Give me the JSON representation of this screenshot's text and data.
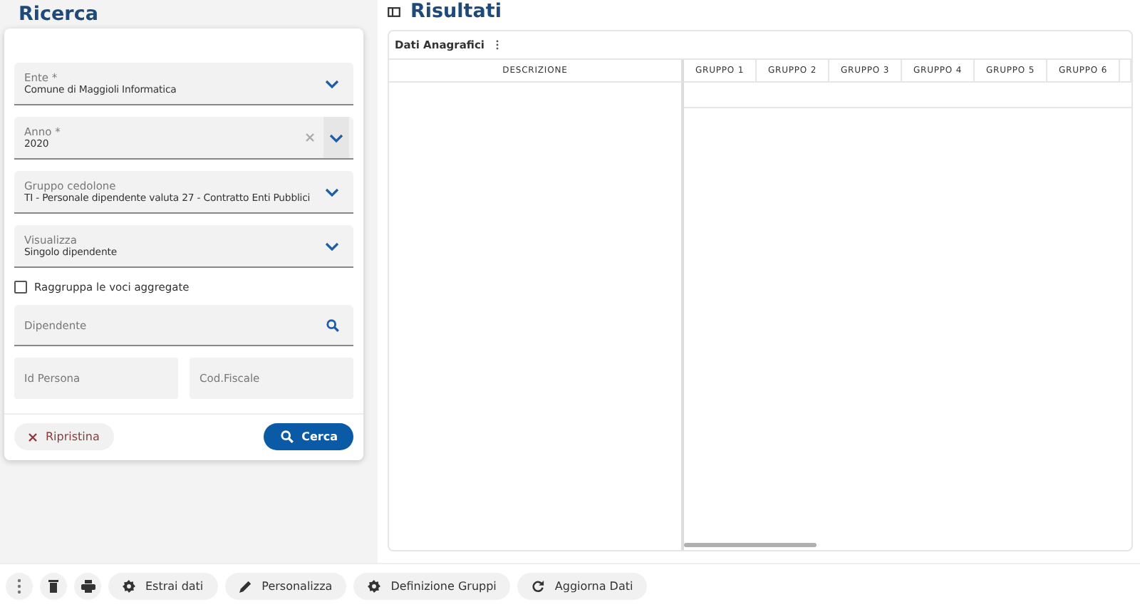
{
  "search_panel": {
    "title": "Ricerca",
    "fields": [
      {
        "kind": "select",
        "label": "Ente *",
        "value": "Comune di Maggioli Informatica"
      },
      {
        "kind": "clearable_select",
        "label": "Anno *",
        "value": "2020"
      },
      {
        "kind": "select",
        "label": "Gruppo cedolone",
        "value": "TI - Personale dipendente valuta 27 - Contratto Enti Pubblici"
      },
      {
        "kind": "select",
        "label": "Visualizza",
        "value": "Singolo dipendente"
      },
      {
        "kind": "checkbox",
        "label": "Raggruppa le voci aggregate",
        "checked": false
      },
      {
        "kind": "search",
        "placeholder": "Dipendente"
      },
      {
        "kind": "pair",
        "placeholders": [
          "Id Persona",
          "Cod.Fiscale"
        ]
      }
    ],
    "reset_button": "Ripristina",
    "search_button": "Cerca"
  },
  "results": {
    "title": "Risultati",
    "table_title": "Dati Anagrafici",
    "columns": [
      "DESCRIZIONE",
      "GRUPPO 1",
      "GRUPPO 2",
      "GRUPPO 3",
      "GRUPPO 4",
      "GRUPPO 5",
      "GRUPPO 6"
    ]
  },
  "toolbar": [
    {
      "kind": "more"
    },
    {
      "kind": "delete"
    },
    {
      "kind": "print"
    },
    {
      "kind": "gear",
      "label": "Estrai dati"
    },
    {
      "kind": "pencil",
      "label": "Personalizza"
    },
    {
      "kind": "gear",
      "label": "Definizione Gruppi"
    },
    {
      "kind": "refresh",
      "label": "Aggiorna Dati"
    }
  ]
}
